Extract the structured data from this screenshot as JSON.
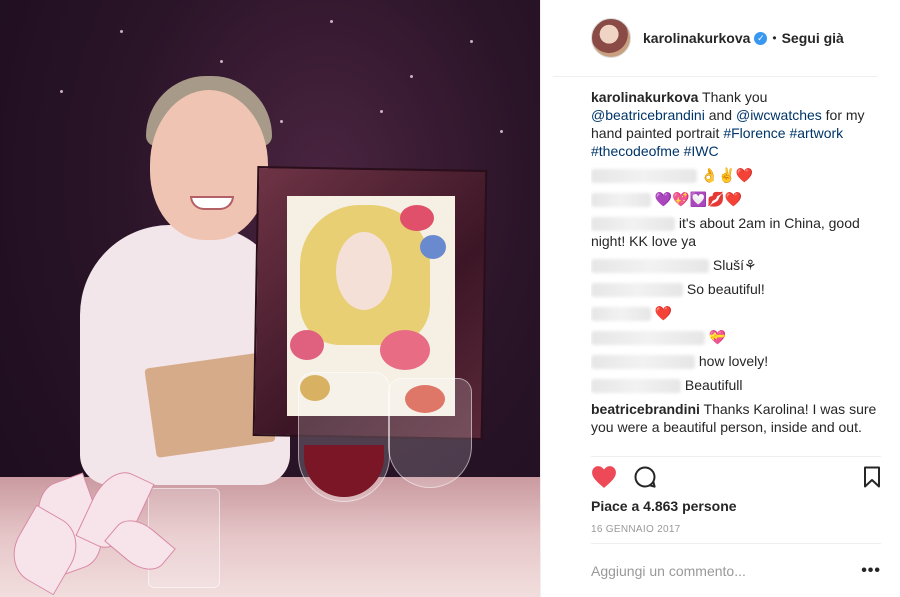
{
  "header": {
    "username": "karolinakurkova",
    "separator": "•",
    "follow_label": "Segui già"
  },
  "caption": {
    "username": "karolinakurkova",
    "text_1": " Thank you ",
    "mention_1": "@beatricebrandini",
    "text_2": " and ",
    "mention_2": "@iwcwatches",
    "text_3": " for my hand painted portrait ",
    "tag_1": "#Florence",
    "tag_2": "#artwork",
    "tag_3": "#thecodeofme",
    "tag_4": "#IWC"
  },
  "comments": [
    {
      "text": "👌✌️❤️"
    },
    {
      "text": "💜💖💟💋❤️"
    },
    {
      "text": "it's about 2am in China, good night! KK love ya"
    },
    {
      "text": "Sluší⚘"
    },
    {
      "text": "So beautiful!"
    },
    {
      "text": "❤️"
    },
    {
      "text": "💝"
    },
    {
      "text": "how lovely!"
    },
    {
      "text": "Beautifull"
    },
    {
      "username": "beatricebrandini",
      "text": " Thanks Karolina! I was sure you were a beautiful person, inside and out."
    }
  ],
  "actions": {
    "like_icon": "heart-icon",
    "comment_icon": "comment-icon",
    "save_icon": "bookmark-icon",
    "like_color": "#ed4956"
  },
  "likes_text": "Piace a 4.863 persone",
  "date_text": "16 GENNAIO 2017",
  "comment_box": {
    "placeholder": "Aggiungi un commento...",
    "more": "•••"
  },
  "colors": {
    "link": "#003569",
    "verified": "#3897f0",
    "muted": "#999999"
  }
}
